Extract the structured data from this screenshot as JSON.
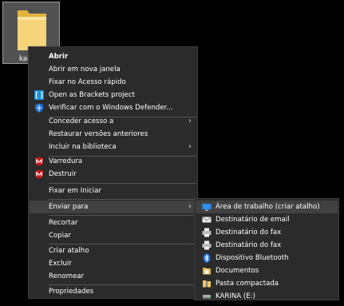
{
  "desktop": {
    "folder_label": "kal",
    "folder_color": "#f0c75e"
  },
  "context_menu": {
    "items": [
      {
        "label": "Abrir",
        "icon": "none"
      },
      {
        "label": "Abrir em nova janela",
        "icon": "none"
      },
      {
        "label": "Fixar no Acesso rápido",
        "icon": "none"
      },
      {
        "label": "Open as Brackets project",
        "icon": "brackets-icon"
      },
      {
        "label": "Verificar com o Windows Defender...",
        "icon": "defender-shield-icon"
      },
      {
        "label": "Conceder acesso a",
        "icon": "none",
        "submenu": true
      },
      {
        "label": "Restaurar versões anteriores",
        "icon": "none"
      },
      {
        "label": "Incluir na biblioteca",
        "icon": "none",
        "submenu": true
      },
      {
        "label": "Varredura",
        "icon": "mcafee-icon"
      },
      {
        "label": "Destruir",
        "icon": "mcafee-icon"
      },
      {
        "label": "Fixar em Iniciar",
        "icon": "none"
      },
      {
        "label": "Enviar para",
        "icon": "none",
        "submenu": true
      },
      {
        "label": "Recortar",
        "icon": "none"
      },
      {
        "label": "Copiar",
        "icon": "none"
      },
      {
        "label": "Criar atalho",
        "icon": "none"
      },
      {
        "label": "Excluir",
        "icon": "none"
      },
      {
        "label": "Renomear",
        "icon": "none"
      },
      {
        "label": "Propriedades",
        "icon": "none"
      }
    ],
    "submenu_arrow": "›"
  },
  "send_to_menu": {
    "items": [
      {
        "label": "Área de trabalho (criar atalho)",
        "icon": "desktop-icon"
      },
      {
        "label": "Destinatário de email",
        "icon": "mail-icon"
      },
      {
        "label": "Destinatário do fax",
        "icon": "fax-icon"
      },
      {
        "label": "Destinatário do fax",
        "icon": "fax-icon"
      },
      {
        "label": "Dispositivo Bluetooth",
        "icon": "bluetooth-icon"
      },
      {
        "label": "Documentos",
        "icon": "documents-icon"
      },
      {
        "label": "Pasta compactada",
        "icon": "zip-folder-icon"
      },
      {
        "label": "KARINA (E:)",
        "icon": "usb-drive-icon"
      }
    ]
  },
  "colors": {
    "menu_bg": "#2b2b2b",
    "highlight": "#414141",
    "mcafee_red": "#c01818",
    "defender_blue": "#1e73d2"
  }
}
